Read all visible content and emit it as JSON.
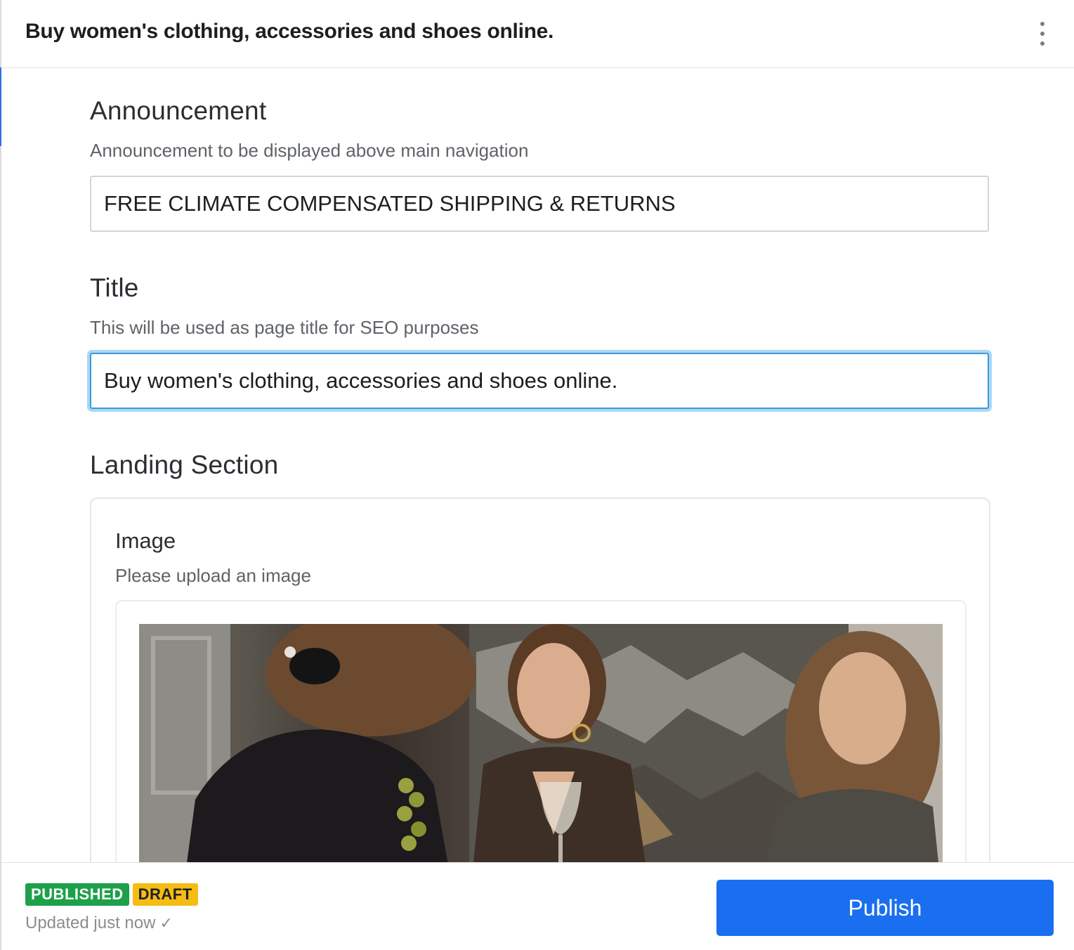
{
  "header": {
    "title": "Buy women's clothing, accessories and shoes online.",
    "menu_icon": "more-vertical-icon"
  },
  "fields": {
    "announcement": {
      "label": "Announcement",
      "description": "Announcement to be displayed above main navigation",
      "value": "FREE CLIMATE COMPENSATED SHIPPING & RETURNS"
    },
    "title": {
      "label": "Title",
      "description": "This will be used as page title for SEO purposes",
      "value": "Buy women's clothing, accessories and shoes online."
    }
  },
  "landing_section": {
    "label": "Landing Section",
    "image": {
      "label": "Image",
      "description": "Please upload an image"
    }
  },
  "footer": {
    "status_badges": [
      "PUBLISHED",
      "DRAFT"
    ],
    "updated_text": "Updated just now",
    "publish_label": "Publish"
  },
  "colors": {
    "accent": "#1a6ff0",
    "focus_ring": "#a9d8f5",
    "published_badge": "#1ea04a",
    "draft_badge": "#f5bd13"
  }
}
